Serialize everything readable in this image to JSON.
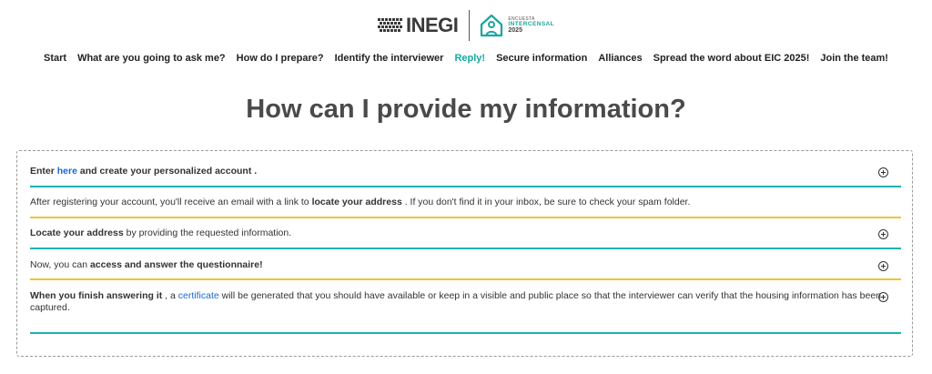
{
  "header": {
    "inegi_logo_text": "INEGI",
    "eic_line1": "ENCUESTA",
    "eic_line2": "INTERCENSAL",
    "eic_line3": "2025"
  },
  "nav": {
    "items": [
      "Start",
      "What are you going to ask me?",
      "How do I prepare?",
      "Identify the interviewer",
      "Reply!",
      "Secure information",
      "Alliances",
      "Spread the word about EIC 2025!",
      "Join the team!"
    ],
    "active": "Reply!"
  },
  "page": {
    "title": "How can I provide my information?"
  },
  "accordion": {
    "item1": {
      "pre": "Enter ",
      "link": "here",
      "post": " and create your personalized account ."
    },
    "item2": {
      "pre": "After registering your account, you'll receive an email with a link to ",
      "bold": "locate your address",
      "post": " . If you don't find it in your inbox, be sure to check your spam folder."
    },
    "item3": {
      "bold": "Locate your address",
      "post": " by providing the requested information."
    },
    "item4": {
      "pre": "Now, you can ",
      "bold": "access and answer the questionnaire!"
    },
    "item5": {
      "bold": "When you finish answering it",
      "mid": " , a ",
      "link": "certificate",
      "post": " will be generated that you should have available or keep in a visible and public place so that the interviewer can verify that the housing information has been captured."
    }
  },
  "colors": {
    "accent_teal": "#1bb3ad",
    "accent_gold": "#f2c233",
    "link_blue": "#1a66d6"
  }
}
